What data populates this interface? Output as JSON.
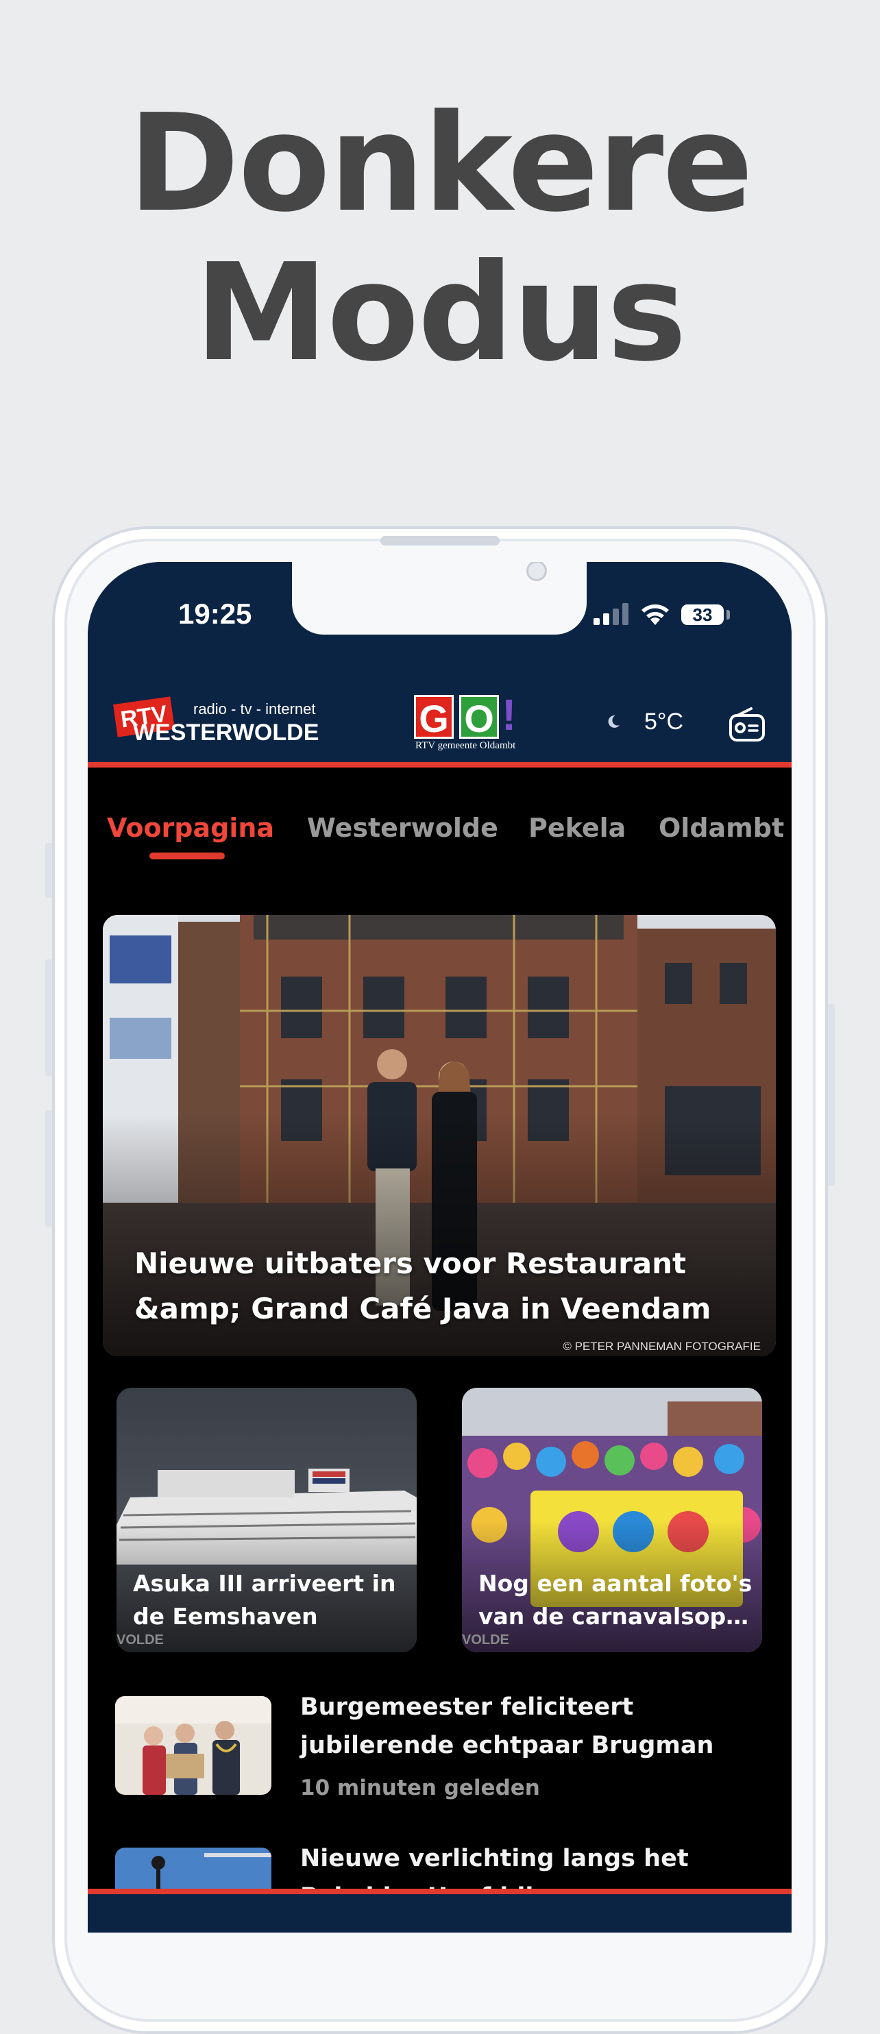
{
  "promo": {
    "title_line1": "Donkere",
    "title_line2": "Modus"
  },
  "status_bar": {
    "time": "19:25",
    "battery": "33"
  },
  "header": {
    "logo_rtv": "RTV",
    "logo_tagline": "radio - tv - internet",
    "logo_name": "WESTERWOLDE",
    "logo_go_g": "G",
    "logo_go_o": "O",
    "logo_go_bang": "!",
    "logo_go_sub": "RTV gemeente Oldambt",
    "temperature": "5°C",
    "weather_icon": "moon-icon",
    "radio_icon": "radio-icon"
  },
  "tabs": [
    {
      "label": "Voorpagina",
      "active": true
    },
    {
      "label": "Westerwolde",
      "active": false
    },
    {
      "label": "Pekela",
      "active": false
    },
    {
      "label": "Oldambt",
      "active": false
    }
  ],
  "hero": {
    "title_line1": "Nieuwe uitbaters voor Restaurant",
    "title_line2": "&amp; Grand Café Java in Veendam",
    "credit": "© PETER PANNEMAN FOTOGRAFIE"
  },
  "cards": [
    {
      "title_line1": "Asuka III arriveert in",
      "title_line2": "de Eemshaven",
      "watermark": "VOLDE"
    },
    {
      "title_line1": "Nog een aantal foto's",
      "title_line2": "van de carnavalsoptocht",
      "watermark": "VOLDE"
    }
  ],
  "list": [
    {
      "title_line1": "Burgemeester feliciteert",
      "title_line2": "jubilerende echtpaar Brugman",
      "time": "10 minuten geleden"
    },
    {
      "title_line1": "Nieuwe verlichting langs het",
      "title_line2": "Pekelder Hoofddiep",
      "time": ""
    }
  ],
  "colors": {
    "navy": "#0c2444",
    "accent_red": "#e23a2e",
    "background": "#ebecee"
  }
}
